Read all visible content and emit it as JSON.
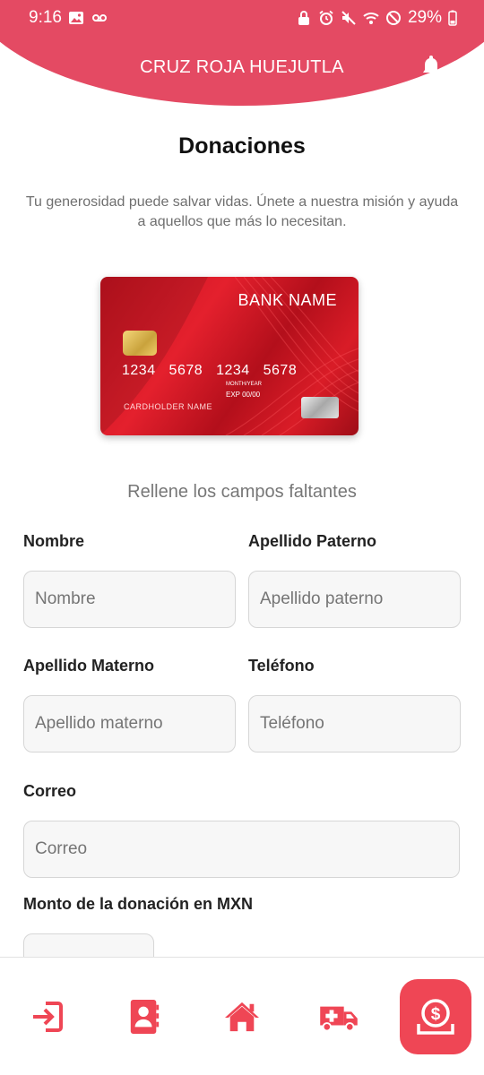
{
  "status_bar": {
    "time": "9:16",
    "battery": "29%"
  },
  "header": {
    "title": "CRUZ ROJA HUEJUTLA",
    "notification_icon": "bell-icon"
  },
  "page": {
    "title": "Donaciones",
    "subtitle": "Tu generosidad puede salvar vidas. Únete a nuestra misión y ayuda a aquellos que más lo necesitan."
  },
  "card": {
    "bank_name": "BANK NAME",
    "number": "1234 5678 1234 5678",
    "month_year_label": "MONTH/YEAR",
    "exp": "EXP  00/00",
    "cardholder": "CARDHOLDER NAME"
  },
  "form": {
    "hint": "Rellene los campos faltantes",
    "nombre": {
      "label": "Nombre",
      "placeholder": "Nombre"
    },
    "apellido_paterno": {
      "label": "Apellido Paterno",
      "placeholder": "Apellido paterno"
    },
    "apellido_materno": {
      "label": "Apellido Materno",
      "placeholder": "Apellido materno"
    },
    "telefono": {
      "label": "Teléfono",
      "placeholder": "Teléfono"
    },
    "correo": {
      "label": "Correo",
      "placeholder": "Correo"
    },
    "monto": {
      "label": "Monto de la donación en MXN",
      "placeholder": ""
    }
  },
  "bottom_nav": {
    "items": [
      {
        "icon": "login-icon",
        "active": false
      },
      {
        "icon": "contacts-icon",
        "active": false
      },
      {
        "icon": "home-icon",
        "active": false
      },
      {
        "icon": "ambulance-icon",
        "active": false
      },
      {
        "icon": "donation-icon",
        "active": true
      }
    ]
  },
  "colors": {
    "brand": "#e44a63",
    "accent": "#ef4655"
  }
}
